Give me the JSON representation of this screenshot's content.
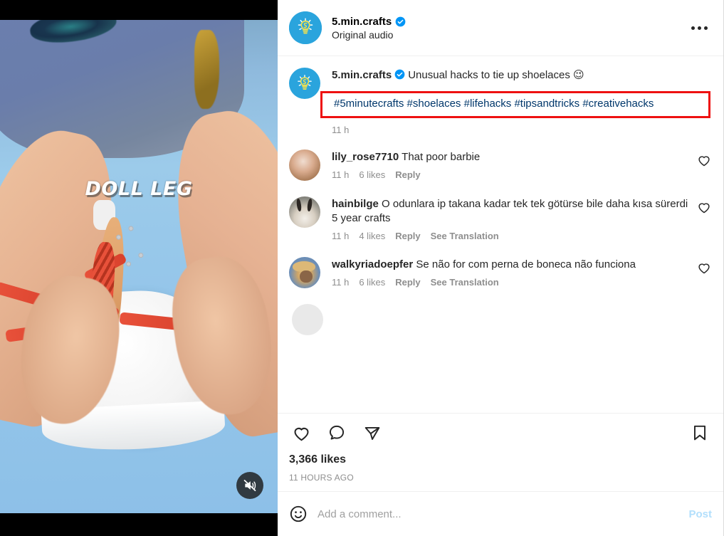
{
  "media": {
    "overlay_caption": "DOLL LEG",
    "mute_icon": "speaker-muted-icon",
    "is_muted": true
  },
  "header": {
    "username": "5.min.crafts",
    "verified": true,
    "audio_label": "Original audio",
    "avatar_icon": "lightbulb-avatar",
    "more_icon": "more-options-icon"
  },
  "caption": {
    "username": "5.min.crafts",
    "verified": true,
    "text": "Unusual hacks to tie up shoelaces",
    "emoji": "😉",
    "hashtags": "#5minutecrafts #shoelaces #lifehacks #tipsandtricks #creativehacks",
    "time": "11 h"
  },
  "comments": [
    {
      "username": "lily_rose7710",
      "text": "That poor barbie",
      "time": "11 h",
      "likes": "6 likes",
      "reply": "Reply",
      "translation": null
    },
    {
      "username": "hainbilge",
      "text": "O odunlara ip takana kadar tek tek götürse bile daha kısa sürerdi 5 year crafts",
      "time": "11 h",
      "likes": "4 likes",
      "reply": "Reply",
      "translation": "See Translation"
    },
    {
      "username": "walkyriadoepfer",
      "text": "Se não for com perna de boneca não funciona",
      "time": "11 h",
      "likes": "6 likes",
      "reply": "Reply",
      "translation": "See Translation"
    }
  ],
  "actions": {
    "like_icon": "heart-icon",
    "comment_icon": "comment-bubble-icon",
    "share_icon": "share-paper-plane-icon",
    "save_icon": "bookmark-icon",
    "likes_count": "3,366 likes",
    "posted_time": "11 HOURS AGO"
  },
  "add_comment": {
    "emoji_icon": "emoji-face-icon",
    "placeholder": "Add a comment...",
    "value": "",
    "post_label": "Post"
  },
  "colors": {
    "link_blue": "#00376b",
    "annotation_red": "#ee1111",
    "verified_blue": "#0095f6",
    "post_disabled": "#b2dffc",
    "muted_text": "#8e8e8e"
  }
}
